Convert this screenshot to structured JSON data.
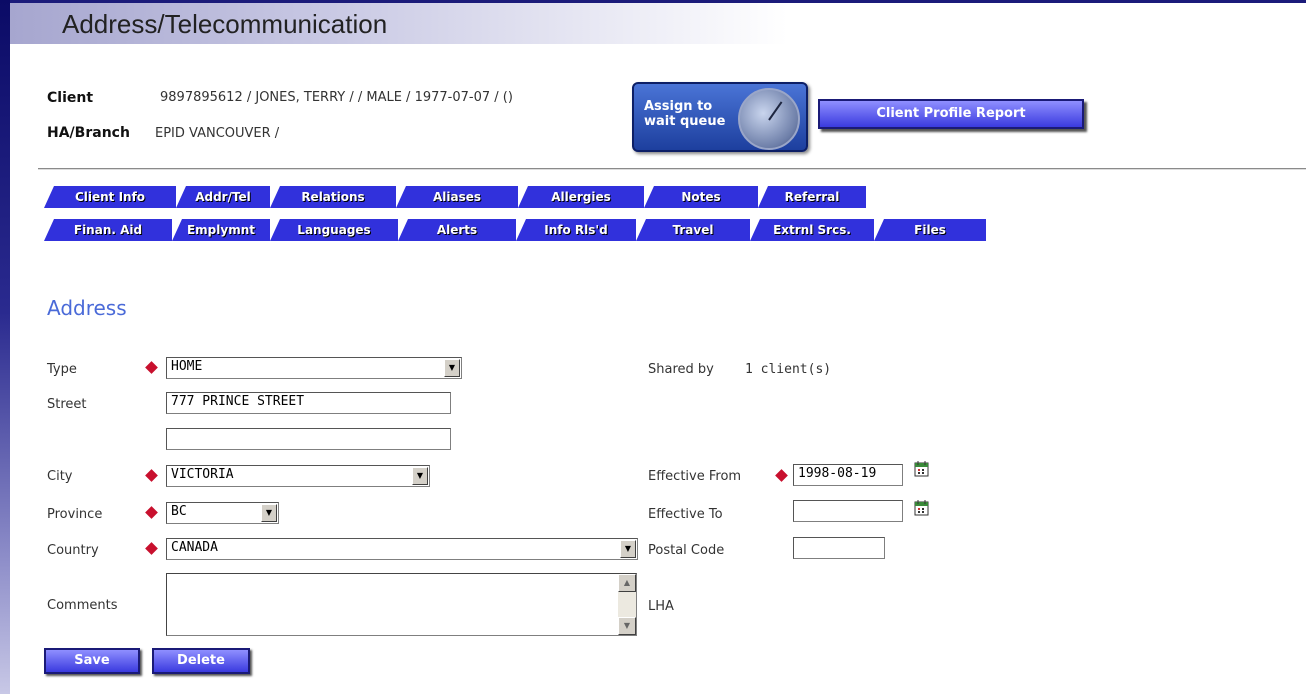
{
  "page": {
    "title": "Address/Telecommunication"
  },
  "client": {
    "client_label": "Client",
    "client_value": "9897895612 / JONES, TERRY / / MALE / 1977-07-07 / ()",
    "branch_label": "HA/Branch",
    "branch_value": "EPID VANCOUVER /"
  },
  "actions": {
    "assign_label": "Assign to wait queue",
    "profile_report_label": "Client Profile Report"
  },
  "tabs_row1": [
    {
      "label": "Client Info"
    },
    {
      "label": "Addr/Tel"
    },
    {
      "label": "Relations"
    },
    {
      "label": "Aliases"
    },
    {
      "label": "Allergies"
    },
    {
      "label": "Notes"
    },
    {
      "label": "Referral"
    }
  ],
  "tabs_row2": [
    {
      "label": "Finan. Aid"
    },
    {
      "label": "Emplymnt"
    },
    {
      "label": "Languages"
    },
    {
      "label": "Alerts"
    },
    {
      "label": "Info Rls'd"
    },
    {
      "label": "Travel"
    },
    {
      "label": "Extrnl Srcs."
    },
    {
      "label": "Files"
    }
  ],
  "address": {
    "section_title": "Address",
    "type_label": "Type",
    "type_value": "HOME",
    "street_label": "Street",
    "street1_value": "777 PRINCE STREET",
    "street2_value": "",
    "city_label": "City",
    "city_value": "VICTORIA",
    "province_label": "Province",
    "province_value": "BC",
    "country_label": "Country",
    "country_value": "CANADA",
    "comments_label": "Comments",
    "comments_value": "",
    "shared_by_label": "Shared by",
    "shared_by_value": "1 client(s)",
    "effective_from_label": "Effective From",
    "effective_from_value": "1998-08-19",
    "effective_to_label": "Effective To",
    "effective_to_value": "",
    "postal_code_label": "Postal Code",
    "postal_code_value": "",
    "lha_label": "LHA"
  },
  "buttons": {
    "save_label": "Save",
    "delete_label": "Delete"
  },
  "colors": {
    "tab_blue": "#3131dc",
    "section_title": "#4a6ad8",
    "required": "#c8102e"
  },
  "icons": [
    "calendar-icon",
    "dropdown-arrow-icon",
    "required-diamond-icon",
    "dial-icon"
  ]
}
